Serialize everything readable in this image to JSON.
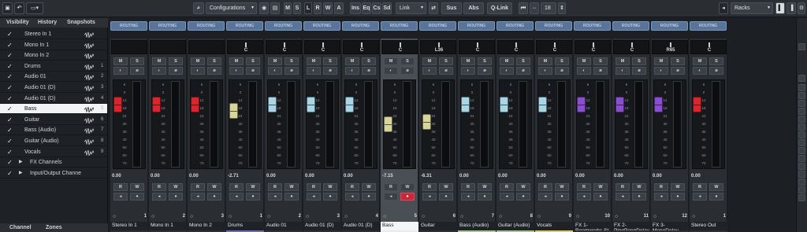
{
  "toolbar": {
    "configurations_label": "Configurations",
    "toggles": [
      "M",
      "S",
      "L",
      "R",
      "W",
      "A"
    ],
    "panels": [
      "Ins",
      "Eq",
      "Cs",
      "Sd"
    ],
    "link_label": "Link",
    "sus_label": "Sus",
    "abs_label": "Abs",
    "qlink_label": "Q-Link",
    "channel_count": "18",
    "racks_label": "Racks"
  },
  "left_panel": {
    "tabs": [
      "Visibility",
      "History",
      "Snapshots"
    ],
    "items": [
      {
        "label": "Stereo In 1",
        "num": "",
        "checked": true
      },
      {
        "label": "Mono In 1",
        "num": "",
        "checked": true
      },
      {
        "label": "Mono In 2",
        "num": "",
        "checked": true
      },
      {
        "label": "Drums",
        "num": "1",
        "checked": true
      },
      {
        "label": "Audio 01",
        "num": "2",
        "checked": true
      },
      {
        "label": "Audio 01 (D)",
        "num": "3",
        "checked": true
      },
      {
        "label": "Audio 01 (D)",
        "num": "4",
        "checked": true
      },
      {
        "label": "Bass",
        "num": "5",
        "checked": true,
        "selected": true
      },
      {
        "label": "Guitar",
        "num": "6",
        "checked": true
      },
      {
        "label": "Bass (Audio)",
        "num": "7",
        "checked": true
      },
      {
        "label": "Guitar (Audio)",
        "num": "8",
        "checked": true
      },
      {
        "label": "Vocals",
        "num": "9",
        "checked": true
      },
      {
        "label": "FX Channels",
        "num": "",
        "checked": true,
        "folder": true
      },
      {
        "label": "Input/Output Channe",
        "num": "",
        "checked": true,
        "folder": true
      }
    ],
    "bottom_tabs": [
      "Channel",
      "Zones"
    ]
  },
  "mixer": {
    "routing_label": "ROUTING",
    "channels": [
      {
        "name": "Stereo In 1",
        "index": "1",
        "pan": "",
        "fader_left": "0.00",
        "fader_right": "",
        "cap": "#d8262e",
        "bar": "#2b2e33",
        "fader_pos": 0.18
      },
      {
        "name": "Mono In 1",
        "index": "2",
        "pan": "",
        "fader_left": "0.00",
        "fader_right": "",
        "cap": "#d8262e",
        "bar": "#2b2e33",
        "fader_pos": 0.18
      },
      {
        "name": "Mono In 2",
        "index": "3",
        "pan": "",
        "fader_left": "0.00",
        "fader_right": "",
        "cap": "#d8262e",
        "bar": "#2b2e33",
        "fader_pos": 0.18
      },
      {
        "name": "Drums",
        "index": "1",
        "pan": "C",
        "fader_left": "-2.71",
        "fader_right": "",
        "cap": "#d8d59a",
        "bar": "#6b6db8",
        "fader_pos": 0.26
      },
      {
        "name": "Audio 01",
        "index": "2",
        "pan": "C",
        "fader_left": "0.00",
        "fader_right": "",
        "cap": "#a9d6e6",
        "bar": "#2b2e33",
        "fader_pos": 0.18
      },
      {
        "name": "Audio 01 (D)",
        "index": "3",
        "pan": "C",
        "fader_left": "0.00",
        "fader_right": "",
        "cap": "#a9d6e6",
        "bar": "#2b2e33",
        "fader_pos": 0.18
      },
      {
        "name": "Audio 01 (D)",
        "index": "4",
        "pan": "C",
        "fader_left": "0.00",
        "fader_right": "",
        "cap": "#a9d6e6",
        "bar": "#2b2e33",
        "fader_pos": 0.18
      },
      {
        "name": "Bass",
        "index": "5",
        "pan": "C",
        "fader_left": "-7.15",
        "fader_right": "",
        "cap": "#d8d59a",
        "bar": "#e9ecef",
        "fader_pos": 0.43,
        "selected": true
      },
      {
        "name": "Guitar",
        "index": "6",
        "pan": "L36",
        "fader_left": "-6.31",
        "fader_right": "",
        "cap": "#d8d59a",
        "bar": "#2b2e33",
        "fader_pos": 0.4
      },
      {
        "name": "Bass (Audio)",
        "index": "7",
        "pan": "C",
        "fader_left": "0.00",
        "fader_right": "",
        "cap": "#a9d6e6",
        "bar": "#a3c98a",
        "fader_pos": 0.18
      },
      {
        "name": "Guitar (Audio)",
        "index": "8",
        "pan": "C",
        "fader_left": "0.00",
        "fader_right": "",
        "cap": "#a9d6e6",
        "bar": "#a3c98a",
        "fader_pos": 0.18
      },
      {
        "name": "Vocals",
        "index": "9",
        "pan": "C",
        "fader_left": "0.00",
        "fader_right": "",
        "cap": "#a9d6e6",
        "bar": "#e1cf4a",
        "fader_pos": 0.18
      },
      {
        "name": "FX 1-Roomworks St",
        "index": "10",
        "pan": "C",
        "fader_left": "0.00",
        "fader_right": "",
        "cap": "#8a4fd0",
        "bar": "#2b2e33",
        "fader_pos": 0.18
      },
      {
        "name": "FX 2-PingPongDelay",
        "index": "11",
        "pan": "C",
        "fader_left": "0.00",
        "fader_right": "",
        "cap": "#8a4fd0",
        "bar": "#2b2e33",
        "fader_pos": 0.18
      },
      {
        "name": "FX 3-MonoDelay",
        "index": "12",
        "pan": "R65",
        "fader_left": "0.00",
        "fader_right": "",
        "cap": "#8a4fd0",
        "bar": "#2b2e33",
        "fader_pos": 0.18
      },
      {
        "name": "Stereo Out",
        "index": "1",
        "pan": "C",
        "fader_left": "0.00",
        "fader_right": "",
        "cap": "#d8262e",
        "bar": "#2b2e33",
        "fader_pos": 0.18
      }
    ],
    "scale_labels": [
      "6",
      "0",
      "12",
      "18",
      "24",
      "30",
      "36",
      "40",
      "50",
      "60",
      "70"
    ],
    "meter_labels": [
      "0",
      "12",
      "18",
      "24",
      "30",
      "40",
      "50",
      "60"
    ]
  }
}
